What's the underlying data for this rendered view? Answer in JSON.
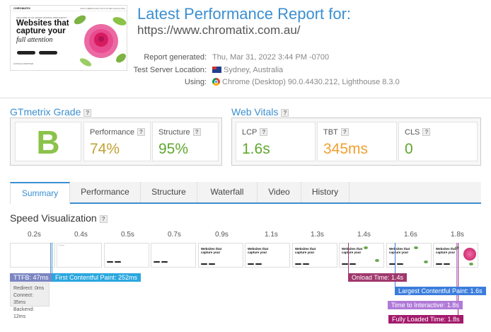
{
  "thumbnail": {
    "logo": "CHROMATIX",
    "nav": [
      "SERVICES",
      "WORK",
      "ABOUT",
      "CONTACT",
      "BLOG",
      "ENQUIRE"
    ],
    "eyebrow": "WELCOME TO AN AWARD WINNING WEB AGENCY",
    "headline": "Websites that capture your",
    "script": "full attention",
    "cert": "GOOGLE PARTNER"
  },
  "header": {
    "title": "Latest Performance Report for:",
    "url": "https://www.chromatix.com.au/",
    "meta": [
      {
        "label": "Report generated:",
        "value": "Thu, Mar 31, 2022 3:44 PM -0700"
      },
      {
        "label": "Test Server Location:",
        "value": "Sydney, Australia",
        "icon": "australia-flag-icon"
      },
      {
        "label": "Using:",
        "value": "Chrome (Desktop) 90.0.4430.212, Lighthouse 8.3.0",
        "icon": "chrome-icon"
      }
    ]
  },
  "grade": {
    "title": "GTmetrix Grade",
    "letter": "B",
    "performance": {
      "label": "Performance",
      "value": "74%",
      "color": "#c2a233"
    },
    "structure": {
      "label": "Structure",
      "value": "95%",
      "color": "#5fa72e"
    }
  },
  "vitals": {
    "title": "Web Vitals",
    "lcp": {
      "label": "LCP",
      "value": "1.6s",
      "color": "#5fa72e"
    },
    "tbt": {
      "label": "TBT",
      "value": "345ms",
      "color": "#f0a030"
    },
    "cls": {
      "label": "CLS",
      "value": "0",
      "color": "#5fa72e"
    }
  },
  "tabs": [
    "Summary",
    "Performance",
    "Structure",
    "Waterfall",
    "Video",
    "History"
  ],
  "speed": {
    "title": "Speed Visualization",
    "ticks": [
      "0.2s",
      "0.4s",
      "0.5s",
      "0.7s",
      "0.9s",
      "1.1s",
      "1.3s",
      "1.4s",
      "1.6s",
      "1.8s"
    ],
    "frame_headline": "Websites that capture your",
    "frame_script": "full attention",
    "ttfb": "TTFB: 47ms",
    "ttfb_details": [
      "Redirect: 0ms",
      "Connect: 35ms",
      "Backend: 12ms"
    ],
    "fcp": "First Contentful Paint: 252ms",
    "onload": "Onload Time: 1.4s",
    "lcp": "Largest Contentful Paint: 1.6s",
    "tti": "Time to Interactive: 1.8s",
    "flt": "Fully Loaded Time: 1.8s"
  }
}
